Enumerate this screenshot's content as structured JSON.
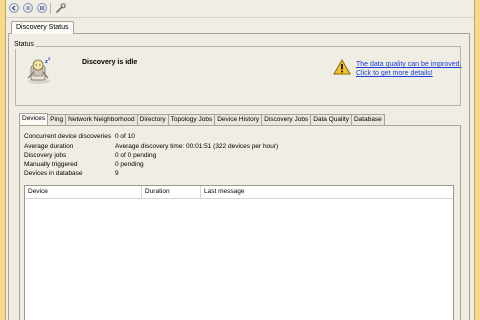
{
  "toolbar": {
    "buttons": [
      {
        "name": "back-button",
        "icon": "arrow-left-icon"
      },
      {
        "name": "stop-button",
        "icon": "stop-icon"
      },
      {
        "name": "pause-button",
        "icon": "pause-icon"
      }
    ],
    "settings_icon": "wrench-icon"
  },
  "main_tab": {
    "label": "Discovery Status"
  },
  "status": {
    "legend": "Status",
    "message": "Discovery is idle",
    "warning_link_line1": "The data quality can be improved.",
    "warning_link_line2": "Click to get more details!"
  },
  "tabs": [
    {
      "label": "Devices",
      "active": true
    },
    {
      "label": "Ping"
    },
    {
      "label": "Network Neighborhood"
    },
    {
      "label": "Directory"
    },
    {
      "label": "Topology Jobs"
    },
    {
      "label": "Device History"
    },
    {
      "label": "Discovery Jobs"
    },
    {
      "label": "Data Quality"
    },
    {
      "label": "Database"
    }
  ],
  "info": [
    {
      "label": "Concurrent device discoveries",
      "value": "0 of 10"
    },
    {
      "label": "Average duration",
      "value": "Average discovery time: 00:01:51 (322 devices per hour)"
    },
    {
      "label": "Discovery jobs",
      "value": "0 of 0 pending"
    },
    {
      "label": "Manually triggered",
      "value": "0 pending"
    },
    {
      "label": "Devices in database",
      "value": "9"
    }
  ],
  "table": {
    "columns": [
      "Device",
      "Duration",
      "Last message"
    ],
    "rows": []
  },
  "colors": {
    "frame": "#f6d98c",
    "link": "#1a3fd6",
    "warning": "#f2c230",
    "panel": "#f0ede4"
  }
}
